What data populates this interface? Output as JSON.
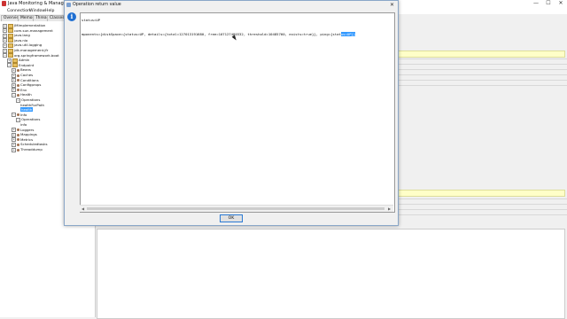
{
  "app": {
    "title": "Java Monitoring & Management C...",
    "window_buttons": [
      "—",
      "☐",
      "✕"
    ]
  },
  "menu": [
    "Connection",
    "Window",
    "Help"
  ],
  "tabs": [
    "Overview",
    "Memory",
    "Threads",
    "Classes"
  ],
  "tree": [
    {
      "label": "JMImplementation",
      "level": 0,
      "toggle": "+",
      "icon": "folder"
    },
    {
      "label": "com.sun.management",
      "level": 0,
      "toggle": "+",
      "icon": "folder"
    },
    {
      "label": "java.lang",
      "level": 0,
      "toggle": "+",
      "icon": "folder"
    },
    {
      "label": "java.nio",
      "level": 0,
      "toggle": "+",
      "icon": "folder"
    },
    {
      "label": "java.util.logging",
      "level": 0,
      "toggle": "+",
      "icon": "folder"
    },
    {
      "label": "jdk.management.jfr",
      "level": 0,
      "toggle": "+",
      "icon": "folder"
    },
    {
      "label": "org.springframework.boot",
      "level": 0,
      "toggle": "−",
      "icon": "folder"
    },
    {
      "label": "Admin",
      "level": 1,
      "toggle": "+",
      "icon": "folder"
    },
    {
      "label": "Endpoint",
      "level": 1,
      "toggle": "−",
      "icon": "folder"
    },
    {
      "label": "Beans",
      "level": 2,
      "toggle": "+",
      "icon": "bean"
    },
    {
      "label": "Caches",
      "level": 2,
      "toggle": "+",
      "icon": "bean"
    },
    {
      "label": "Conditions",
      "level": 2,
      "toggle": "+",
      "icon": "bean"
    },
    {
      "label": "Configprops",
      "level": 2,
      "toggle": "+",
      "icon": "bean"
    },
    {
      "label": "Env",
      "level": 2,
      "toggle": "+",
      "icon": "bean"
    },
    {
      "label": "Health",
      "level": 2,
      "toggle": "−",
      "icon": "bean"
    },
    {
      "label": "Operations",
      "level": 3,
      "toggle": "−",
      "icon": "none"
    },
    {
      "label": "healthForPath",
      "level": 4,
      "toggle": "",
      "icon": "none"
    },
    {
      "label": "health",
      "level": 4,
      "toggle": "",
      "icon": "none",
      "selected": true
    },
    {
      "label": "Info",
      "level": 2,
      "toggle": "−",
      "icon": "bean"
    },
    {
      "label": "Operations",
      "level": 3,
      "toggle": "−",
      "icon": "none"
    },
    {
      "label": "info",
      "level": 4,
      "toggle": "",
      "icon": "none"
    },
    {
      "label": "Loggers",
      "level": 2,
      "toggle": "+",
      "icon": "bean"
    },
    {
      "label": "Mappings",
      "level": 2,
      "toggle": "+",
      "icon": "bean"
    },
    {
      "label": "Metrics",
      "level": 2,
      "toggle": "+",
      "icon": "bean"
    },
    {
      "label": "Scheduledtasks",
      "level": 2,
      "toggle": "+",
      "icon": "bean"
    },
    {
      "label": "Threaddump",
      "level": 2,
      "toggle": "+",
      "icon": "bean"
    }
  ],
  "dialog": {
    "title": "Operation return value",
    "close": "✕",
    "line1": "status=UP",
    "line2_plain": "mponents={diskSpace={status=UP, details={total=127013191680, free=107127480332, threshold=10485760, exists=true}}, ping={stat",
    "line2_selected": "us=UP}}",
    "ok_label": "OK",
    "scroll_left": "◀",
    "scroll_right": "▶"
  },
  "colors": {
    "selection": "#3399ff",
    "highlight_row": "#ffffc8",
    "info_icon": "#1f6fd1"
  }
}
